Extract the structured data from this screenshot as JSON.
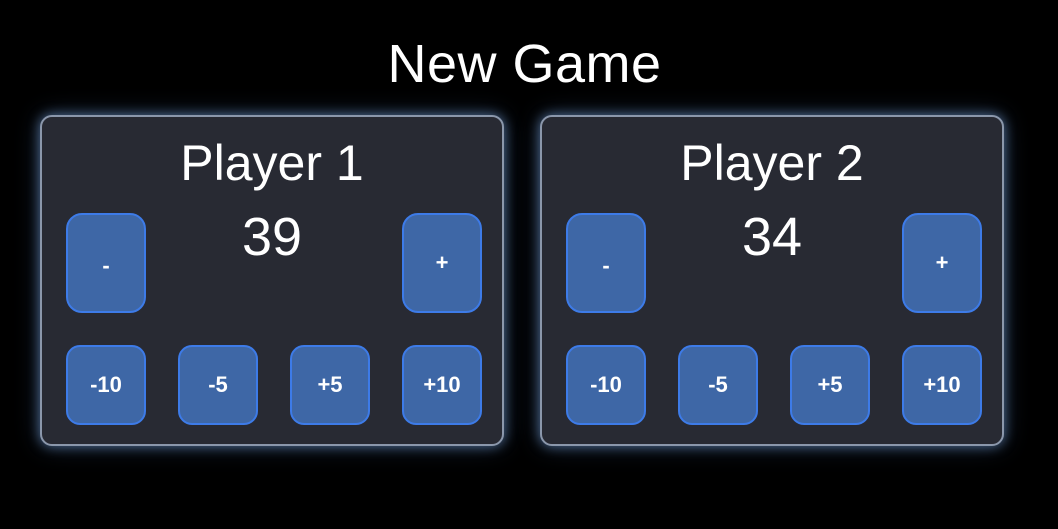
{
  "header": {
    "title": "New Game"
  },
  "players": [
    {
      "name": "Player 1",
      "score": "39",
      "buttons": {
        "minus": "-",
        "plus": "+",
        "minus10": "-10",
        "minus5": "-5",
        "plus5": "+5",
        "plus10": "+10"
      }
    },
    {
      "name": "Player 2",
      "score": "34",
      "buttons": {
        "minus": "-",
        "plus": "+",
        "minus10": "-10",
        "minus5": "-5",
        "plus5": "+5",
        "plus10": "+10"
      }
    }
  ],
  "colors": {
    "background": "#000000",
    "panel": "#282a33",
    "panel_border": "#8b97ab",
    "button": "#3e67a6",
    "button_border": "#3d7be8",
    "text": "#ffffff"
  }
}
